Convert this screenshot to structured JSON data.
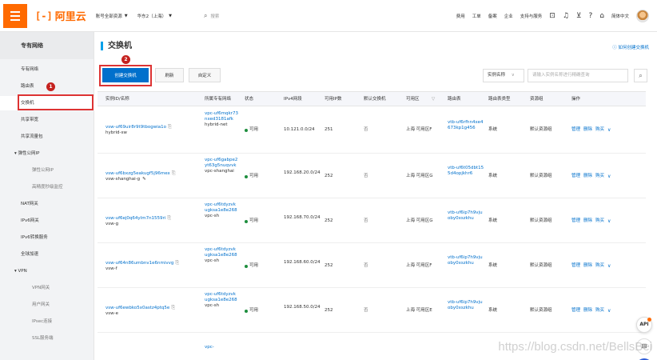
{
  "topbar": {
    "logo_text": "阿里云",
    "account_dropdown": "账号全部资源",
    "region_dropdown": "华东2（上海）",
    "search_placeholder": "搜索",
    "links": [
      "费用",
      "工单",
      "备案",
      "企业",
      "支持与服务"
    ],
    "language": "简体中文",
    "accent_color": "#ff6a00"
  },
  "sidebar": {
    "title": "专有网络",
    "items": [
      {
        "label": "专有网络"
      },
      {
        "label": "路由表"
      },
      {
        "label": "交换机"
      },
      {
        "label": "共享带宽"
      },
      {
        "label": "共享流量包"
      },
      {
        "label": "弹性公网IP"
      },
      {
        "label": "弹性公网IP"
      },
      {
        "label": "高精度秒级监控"
      },
      {
        "label": "NAT网关"
      },
      {
        "label": "IPv6网关"
      },
      {
        "label": "IPv6转换服务"
      },
      {
        "label": "全球加速"
      },
      {
        "label": "VPN"
      },
      {
        "label": "VPN网关"
      },
      {
        "label": "用户网关"
      },
      {
        "label": "IPsec连接"
      },
      {
        "label": "SSL服务端"
      }
    ],
    "badge_1": "1"
  },
  "main": {
    "title": "交换机",
    "help_link": "如何创建交换机",
    "badge_2": "2",
    "create_button": "创建交换机",
    "refresh_button": "刷新",
    "custom_button": "自定义",
    "filter_select": "实例名称",
    "filter_placeholder": "请输入实例名称进行精确查询"
  },
  "table": {
    "headers": [
      "实例ID/名称",
      "所属专有网络",
      "状态",
      "IPv4网段",
      "可用IP数",
      "默认交换机",
      "可用区",
      "路由表",
      "路由表类型",
      "资源组",
      "操作"
    ],
    "rows": [
      {
        "id": "vsw-uf69uir8r9t9tbogwia1o",
        "name": "hybrid-sw",
        "vpc": "vpc-uf6mqkr73nxed3181afk",
        "vpc_name": "hybrid-net",
        "status": "可用",
        "cidr": "10.121.0.0/24",
        "ips": "251",
        "default": "否",
        "zone": "上海 可用区F",
        "rt": "vtb-uf6rfhn4xe4673kp1g456",
        "rt_type": "系统",
        "rg": "默认资源组",
        "op1": "管理",
        "op2": "删除",
        "op3": "购买"
      },
      {
        "id": "vsw-uf6bxzg5eakugf5j96mex",
        "name": "vsw-shanghai-g",
        "vpc": "vpc-uf6gabpe2yt63g5nuqvvk",
        "vpc_name": "vpc-shanghai",
        "status": "可用",
        "cidr": "192.168.20.0/24",
        "ips": "252",
        "default": "否",
        "zone": "上海 可用区G",
        "rt": "vtb-uf6t05dbt155d4opjkhr6",
        "rt_type": "系统",
        "rg": "默认资源组",
        "op1": "管理",
        "op2": "删除",
        "op3": "购买"
      },
      {
        "id": "vsw-uf6ej0q64ylm7n1559ri",
        "name": "vsw-g",
        "vpc": "vpc-uf6tdyzvkugksa1e8e268",
        "vpc_name": "vpc-sh",
        "status": "可用",
        "cidr": "192.168.70.0/24",
        "ips": "252",
        "default": "否",
        "zone": "上海 可用区G",
        "rt": "vtb-uf6ip7h9vjuoby0xszkhu",
        "rt_type": "系统",
        "rg": "默认资源组",
        "op1": "管理",
        "op2": "删除",
        "op3": "购买"
      },
      {
        "id": "vsw-uf64n86umbnv1e6nmivvg",
        "name": "vsw-f",
        "vpc": "vpc-uf6tdyzvkugksa1e8e268",
        "vpc_name": "vpc-sh",
        "status": "可用",
        "cidr": "192.168.60.0/24",
        "ips": "252",
        "default": "否",
        "zone": "上海 可用区F",
        "rt": "vtb-uf6ip7h9vjuoby0xszkhu",
        "rt_type": "系统",
        "rg": "默认资源组",
        "op1": "管理",
        "op2": "删除",
        "op3": "购买"
      },
      {
        "id": "vsw-uf6ewbko5x0astz4ptq5e",
        "name": "vsw-e",
        "vpc": "vpc-uf6tdyzvkugksa1e8e268",
        "vpc_name": "vpc-sh",
        "status": "可用",
        "cidr": "192.168.50.0/24",
        "ips": "252",
        "default": "否",
        "zone": "上海 可用区E",
        "rt": "vtb-uf6ip7h9vjuoby0xszkhu",
        "rt_type": "系统",
        "rg": "默认资源组",
        "op1": "管理",
        "op2": "删除",
        "op3": "购买"
      }
    ],
    "partial_last_vpc": "vpc-"
  },
  "floating": {
    "api_label": "API"
  },
  "watermark": "https://blog.csdn.net/BellsBei"
}
